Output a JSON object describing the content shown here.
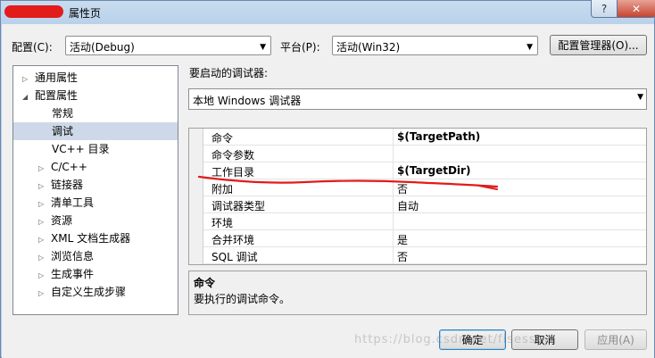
{
  "window": {
    "title": "属性页",
    "help_glyph": "?",
    "close_glyph": "✕"
  },
  "toolbar": {
    "config_label": "配置(C):",
    "config_value": "活动(Debug)",
    "platform_label": "平台(P):",
    "platform_value": "活动(Win32)",
    "config_manager_label": "配置管理器(O)..."
  },
  "tree": {
    "items": [
      {
        "label": "通用属性",
        "twisty": "▷"
      },
      {
        "label": "配置属性",
        "twisty": "◢"
      },
      {
        "label": "常规",
        "twisty": ""
      },
      {
        "label": "调试",
        "twisty": "",
        "selected": true
      },
      {
        "label": "VC++ 目录",
        "twisty": ""
      },
      {
        "label": "C/C++",
        "twisty": "▷"
      },
      {
        "label": "链接器",
        "twisty": "▷"
      },
      {
        "label": "清单工具",
        "twisty": "▷"
      },
      {
        "label": "资源",
        "twisty": "▷"
      },
      {
        "label": "XML 文档生成器",
        "twisty": "▷"
      },
      {
        "label": "浏览信息",
        "twisty": "▷"
      },
      {
        "label": "生成事件",
        "twisty": "▷"
      },
      {
        "label": "自定义生成步骤",
        "twisty": "▷"
      }
    ]
  },
  "main": {
    "debugger_label": "要启动的调试器:",
    "debugger_value": "本地 Windows 调试器",
    "properties": [
      {
        "name": "命令",
        "value": "$(TargetPath)",
        "bold": true
      },
      {
        "name": "命令参数",
        "value": ""
      },
      {
        "name": "工作目录",
        "value": "$(TargetDir)",
        "bold": true
      },
      {
        "name": "附加",
        "value": "否"
      },
      {
        "name": "调试器类型",
        "value": "自动"
      },
      {
        "name": "环境",
        "value": ""
      },
      {
        "name": "合并环境",
        "value": "是"
      },
      {
        "name": "SQL 调试",
        "value": "否"
      }
    ],
    "description_title": "命令",
    "description_text": "要执行的调试命令。"
  },
  "footer": {
    "ok_label": "确定",
    "cancel_label": "取消",
    "apply_label": "应用(A)"
  },
  "watermark": "https://blog.csdn.net/fisesssy",
  "colors": {
    "annotation": "#e21b1b",
    "selection": "#cdd9e8"
  }
}
